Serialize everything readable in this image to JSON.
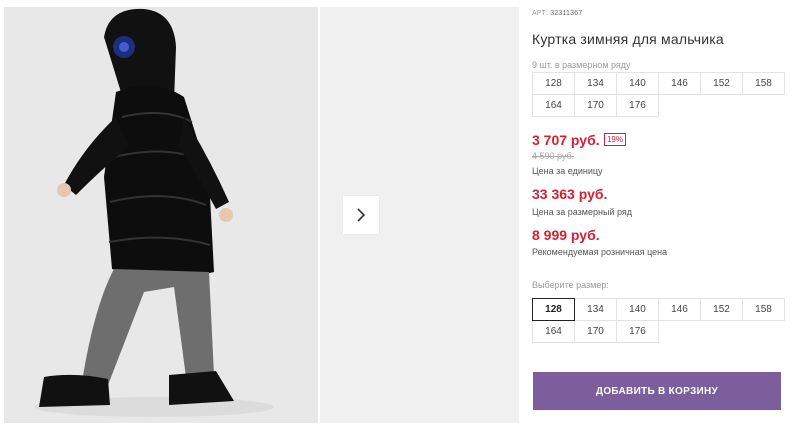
{
  "product": {
    "art_label": "АРТ:",
    "art_number": "32311367",
    "title": "Куртка зимняя для мальчика",
    "set_count_text": "9 шт. в размерном ряду"
  },
  "size_set": [
    "128",
    "134",
    "140",
    "146",
    "152",
    "158",
    "164",
    "170",
    "176"
  ],
  "prices": {
    "current": "3 707 руб.",
    "discount_badge": "19%",
    "old": "4 590 руб.",
    "per_unit_label": "Цена за единицу",
    "set_price": "33 363 руб.",
    "set_price_label": "Цена за размерный ряд",
    "retail_price": "8 999 руб.",
    "retail_price_label": "Рекомендуемая розничная цена"
  },
  "size_picker": {
    "label": "Выберите размер:",
    "sizes": [
      "128",
      "134",
      "140",
      "146",
      "152",
      "158",
      "164",
      "170",
      "176"
    ],
    "selected": "128"
  },
  "cart_button_label": "ДОБАВИТЬ В КОРЗИНУ",
  "icons": {
    "next": "chevron-right-icon"
  },
  "colors": {
    "price_red": "#d32032",
    "cart_button": "#7c5e9c"
  }
}
